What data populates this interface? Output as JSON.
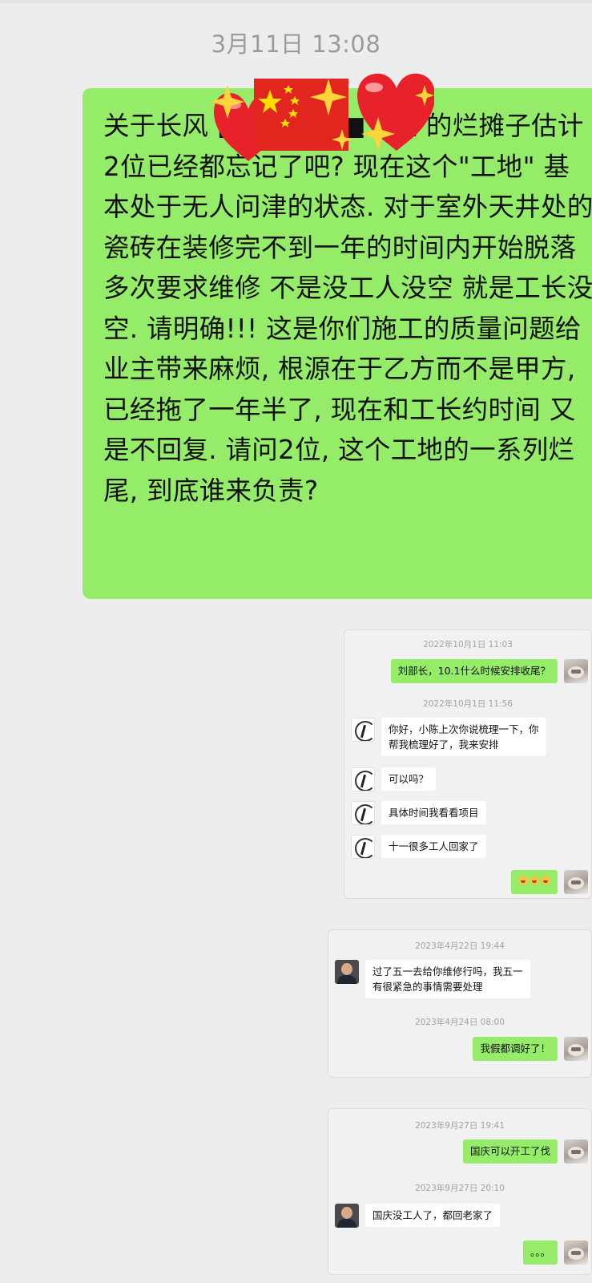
{
  "header": {
    "timestamp": "3月11日 13:08"
  },
  "main_message": {
    "text": "关于长风 ■■■■■■ 0室 的烂摊子估计2位已经都忘记了吧? 现在这个\"工地\" 基本处于无人问津的状态. 对于室外天井处的瓷砖在装修完不到一年的时间内开始脱落 多次要求维修 不是没工人没空 就是工长没空. 请明确!!! 这是你们施工的质量问题给业主带来麻烦, 根源在于乙方而不是甲方, 已经拖了一年半了, 现在和工长约时间 又是不回复. 请问2位, 这个工地的一系列烂尾, 到底谁来负责?",
    "stickers": [
      "sparkles-icon",
      "heart-icon",
      "china-flag-icon",
      "sparkles-icon",
      "heart-icon"
    ]
  },
  "screenshot1": {
    "ts1": "2022年10月1日 11:03",
    "msg1": "刘部长，10.1什么时候安排收尾？",
    "ts2": "2022年10月1日 11:56",
    "reply1_line1": "你好，小陈上次你说梳理一下，你",
    "reply1_line2": "帮我梳理好了，我来安排",
    "reply2": "可以吗？",
    "reply3": "具体时间我看看项目",
    "reply4": "十一很多工人回家了",
    "emoji_reply": [
      "laugh-cry-emoji",
      "laugh-cry-emoji",
      "laugh-cry-emoji"
    ]
  },
  "screenshot2": {
    "ts1": "2023年4月22日 19:44",
    "reply_line1": "过了五一去给你维修行吗，我五一",
    "reply_line2": "有很紧急的事情需要处理",
    "ts2": "2023年4月24日 08:00",
    "msg": "我假都调好了！"
  },
  "screenshot3": {
    "ts1": "2023年9月27日 19:41",
    "msg1": "国庆可以开工了伐",
    "ts2": "2023年9月27日 20:10",
    "reply": "国庆没工人了，都回老家了",
    "msg2": "。。。"
  }
}
